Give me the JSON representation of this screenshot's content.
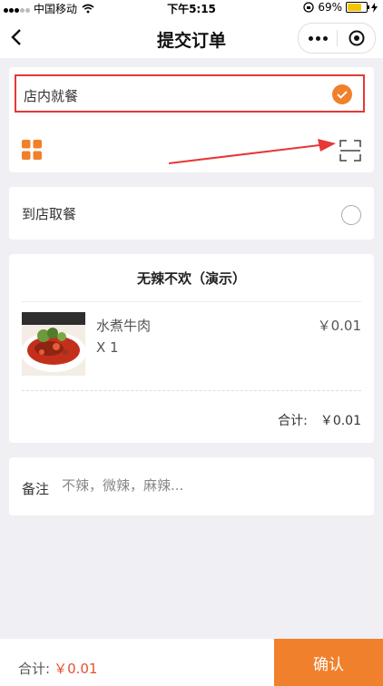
{
  "status_bar": {
    "carrier": "中国移动",
    "time": "下午5:15",
    "battery": "69%"
  },
  "nav": {
    "title": "提交订单"
  },
  "options": {
    "dine_in": {
      "label": "店内就餐",
      "selected": true
    },
    "pickup": {
      "label": "到店取餐",
      "selected": false
    }
  },
  "order": {
    "shop_name": "无辣不欢（演示）",
    "items": [
      {
        "name": "水煮牛肉",
        "quantity": "X 1",
        "price": "￥0.01"
      }
    ],
    "subtotal_label": "合计:",
    "subtotal_amount": "￥0.01"
  },
  "remark": {
    "label": "备注",
    "placeholder": "不辣，微辣，麻辣..."
  },
  "footer": {
    "total_label": "合计:",
    "total_amount": "￥0.01",
    "confirm_label": "确认"
  },
  "colors": {
    "accent": "#f0802c",
    "highlight_border": "#e53935",
    "price_red": "#e5502b"
  },
  "icons": [
    "wifi-icon",
    "back-icon",
    "more-icon",
    "close-capsule-icon",
    "checkmark-icon",
    "grid-icon",
    "scan-icon",
    "arrow-annotation-icon"
  ]
}
